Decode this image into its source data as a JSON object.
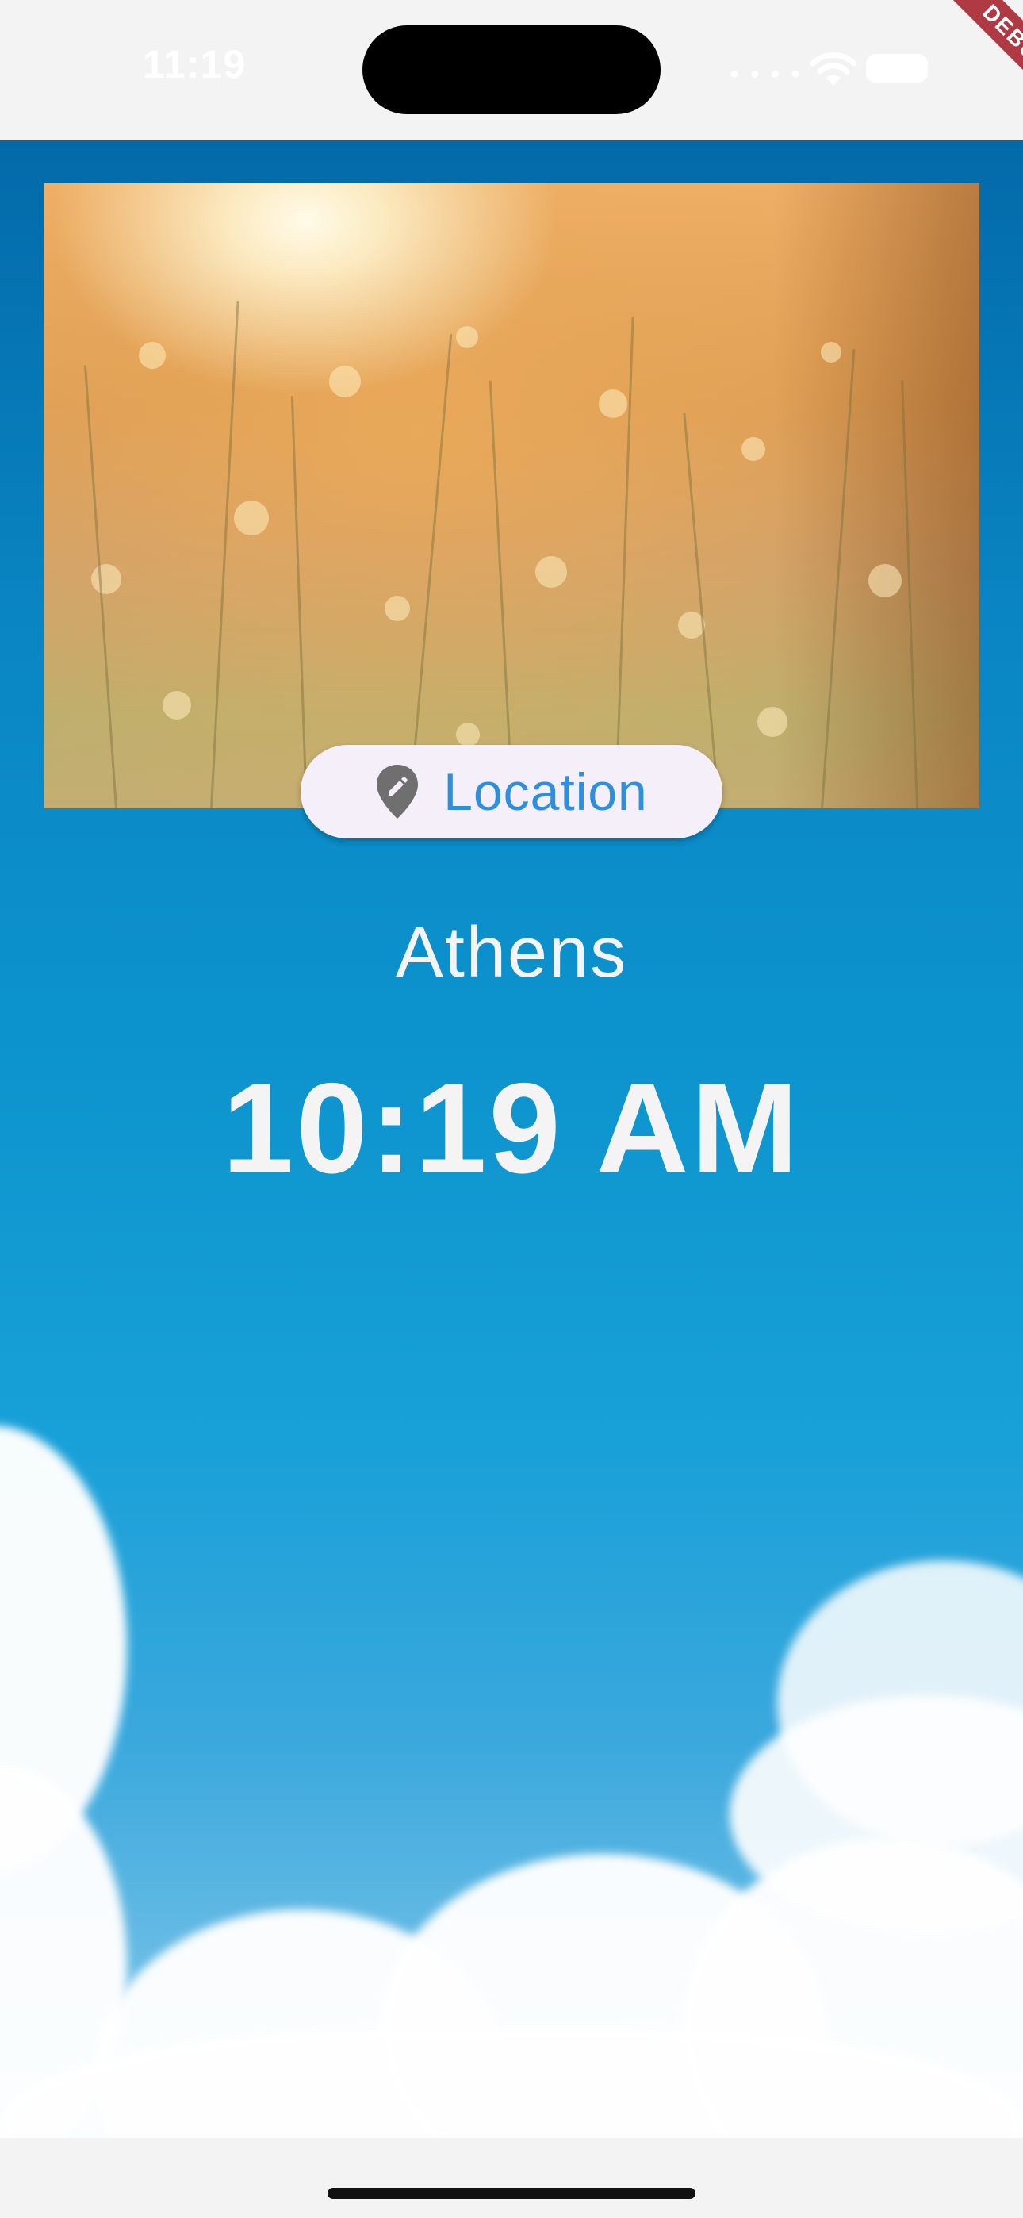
{
  "status_bar": {
    "time": "11:19",
    "icons": [
      "signal-icon",
      "wifi-icon",
      "battery-icon"
    ]
  },
  "debug_banner": {
    "label": "DEBUG"
  },
  "background": {
    "image": "sky-with-clouds",
    "photo": "sunlit-grass-field"
  },
  "location_button": {
    "label": "Location",
    "icon": "location-edit-pin-icon"
  },
  "city": {
    "name": "Athens"
  },
  "clock": {
    "time": "10:19 AM"
  },
  "colors": {
    "accent": "#2f8fdc",
    "button_bg": "#f4eff8",
    "text": "#f4f4f4",
    "sky_top": "#036aa9",
    "debug": "#b03a44"
  }
}
